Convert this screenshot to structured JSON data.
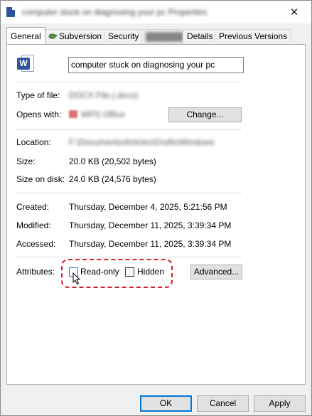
{
  "window": {
    "title": "computer stuck on diagnosing your pc Properties",
    "close_glyph": "✕"
  },
  "tabs": [
    {
      "label": "General"
    },
    {
      "label": "Subversion"
    },
    {
      "label": "Security"
    },
    {
      "label": "Details"
    },
    {
      "label": "Previous Versions"
    }
  ],
  "general": {
    "file_name": "computer stuck on diagnosing your pc",
    "type_label": "Type of file:",
    "type_value": "DOCX File (.docx)",
    "opens_label": "Opens with:",
    "opens_value": "WPS Office",
    "change_button": "Change...",
    "location_label": "Location:",
    "location_value": "F:\\Documents\\Articles\\Drafts\\Windows",
    "size_label": "Size:",
    "size_value": "20.0 KB (20,502 bytes)",
    "size_on_disk_label": "Size on disk:",
    "size_on_disk_value": "24.0 KB (24,576 bytes)",
    "created_label": "Created:",
    "created_value": "Thursday, December 4, 2025, 5:21:56 PM",
    "modified_label": "Modified:",
    "modified_value": "Thursday, December 11, 2025, 3:39:34 PM",
    "accessed_label": "Accessed:",
    "accessed_value": "Thursday, December 11, 2025, 3:39:34 PM",
    "attributes_label": "Attributes:",
    "readonly_label": "Read-only",
    "readonly_checked": false,
    "hidden_label": "Hidden",
    "hidden_checked": false,
    "advanced_button": "Advanced..."
  },
  "footer": {
    "ok": "OK",
    "cancel": "Cancel",
    "apply": "Apply"
  },
  "colors": {
    "highlight": "#d61e2a",
    "word_brand": "#2b579a",
    "focus": "#0078d7"
  },
  "icons": {
    "title": "word-document-icon",
    "file": "word-document-icon",
    "subversion_tab": "tortoise-svn-icon",
    "opens_with": "wps-office-icon",
    "cursor": "mouse-pointer-icon"
  }
}
